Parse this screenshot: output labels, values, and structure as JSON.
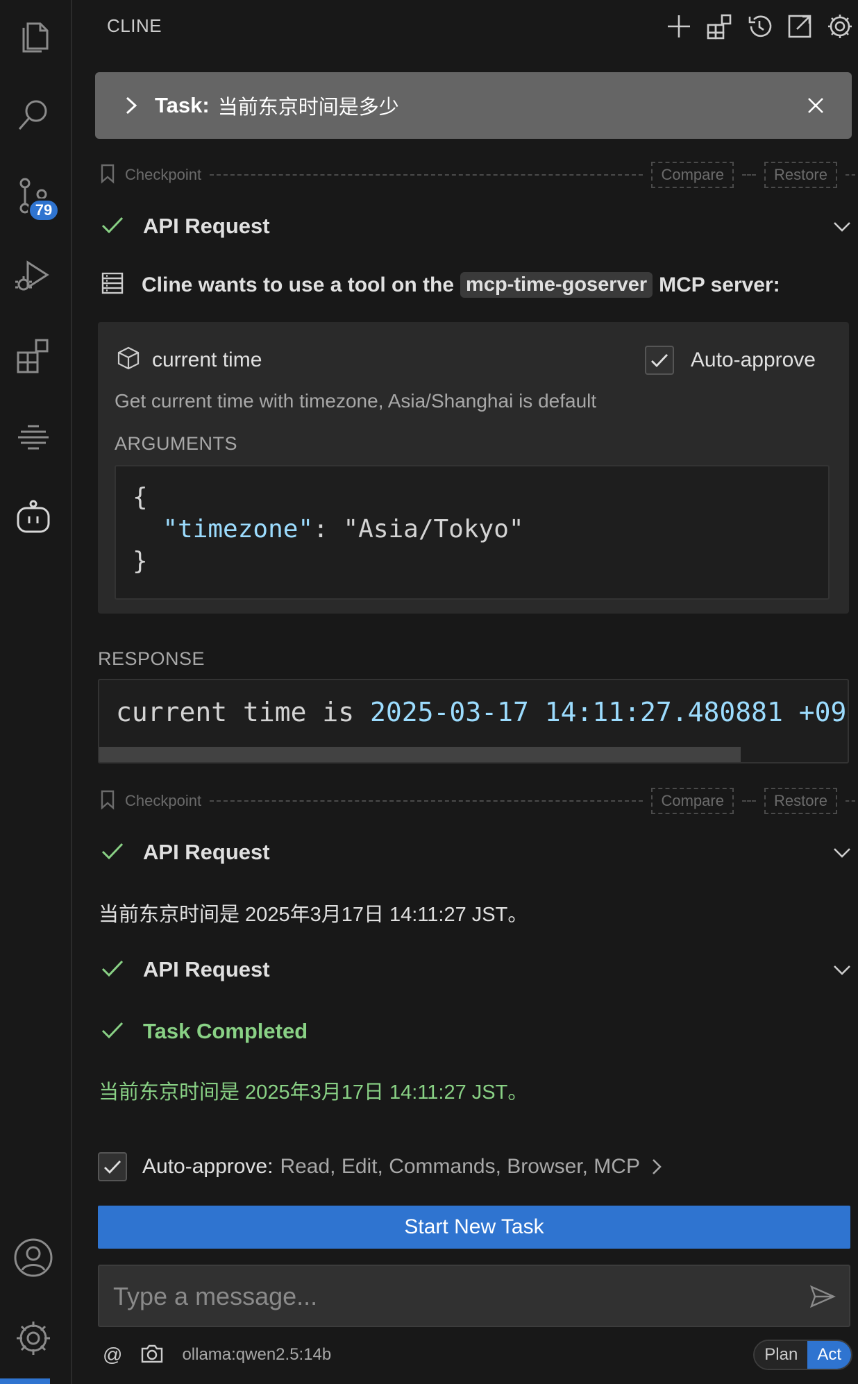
{
  "activity_bar": {
    "items": [
      {
        "icon": "files-icon"
      },
      {
        "icon": "search-icon"
      },
      {
        "icon": "source-control-icon",
        "badge": "79"
      },
      {
        "icon": "run-debug-icon"
      },
      {
        "icon": "extensions-icon"
      },
      {
        "icon": "containers-icon"
      },
      {
        "icon": "cline-robot-icon"
      }
    ],
    "bottom": [
      {
        "icon": "account-icon"
      },
      {
        "icon": "manage-gear-icon"
      }
    ]
  },
  "header": {
    "title": "CLINE",
    "actions": [
      "plus-icon",
      "mcp-servers-icon",
      "history-icon",
      "popout-icon",
      "settings-icon"
    ]
  },
  "task": {
    "label": "Task:",
    "text": "当前东京时间是多少"
  },
  "checkpoint": {
    "label": "Checkpoint",
    "compare": "Compare",
    "restore": "Restore"
  },
  "api_request_label": "API Request",
  "tool_use": {
    "prefix": "Cline wants to use a tool on the",
    "server": "mcp-time-goserver",
    "suffix": "MCP server:",
    "tool_name": "current time",
    "auto_approve": "Auto-approve",
    "description": "Get current time with timezone, Asia/Shanghai is default",
    "arguments_label": "ARGUMENTS",
    "arguments": {
      "open": "{",
      "key": "\"timezone\"",
      "sep": ": ",
      "value": "\"Asia/Tokyo\"",
      "close": "}"
    }
  },
  "response": {
    "label": "RESPONSE",
    "prefix": "current time is ",
    "value": "2025-03-17 14:11:27.480881 +09"
  },
  "assistant_message": "当前东京时间是 2025年3月17日 14:11:27 JST。",
  "task_completed": {
    "label": "Task Completed",
    "text": "当前东京时间是 2025年3月17日 14:11:27 JST。"
  },
  "auto_approve_bar": {
    "label": "Auto-approve:",
    "items": "Read, Edit, Commands, Browser, MCP"
  },
  "start_new_task": "Start New Task",
  "message_input": {
    "placeholder": "Type a message..."
  },
  "footer": {
    "at": "@",
    "model": "ollama:qwen2.5:14b",
    "modes": [
      "Plan",
      "Act"
    ],
    "active_mode": "Act"
  },
  "colors": {
    "accent": "#2f74d0",
    "success": "#89d185",
    "json_key": "#9cdcfe"
  }
}
